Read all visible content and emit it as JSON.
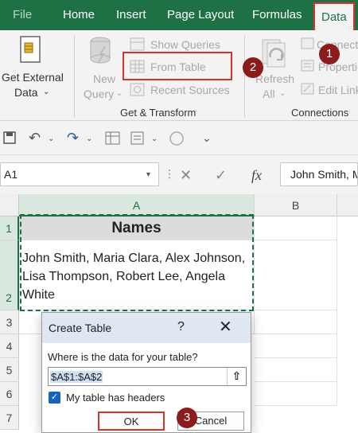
{
  "ribbon_tabs": [
    {
      "label": "File"
    },
    {
      "label": "Home"
    },
    {
      "label": "Insert"
    },
    {
      "label": "Page Layout"
    },
    {
      "label": "Formulas"
    },
    {
      "label": "Data"
    }
  ],
  "get_external_data": {
    "line1": "Get External",
    "line2": "Data"
  },
  "new_query": {
    "line1": "New",
    "line2": "Query"
  },
  "get_transform": {
    "show_queries": "Show Queries",
    "from_table": "From Table",
    "recent_sources": "Recent Sources",
    "group_label": "Get & Transform"
  },
  "refresh_all": {
    "line1": "Refresh",
    "line2": "All"
  },
  "connections": {
    "connections_item": "Connections",
    "properties_item": "Properties",
    "edit_links_item": "Edit Links",
    "group_label": "Connections"
  },
  "formula_bar": {
    "name_box": "A1",
    "fx": "fx",
    "value": "John Smith, Maria Clara, Alex Johnson, Lisa Thompson, Robert Lee, Angela White"
  },
  "grid": {
    "columns": [
      "A",
      "B"
    ],
    "rows": [
      "1",
      "2",
      "3",
      "4",
      "5",
      "6",
      "7"
    ],
    "a1": "Names",
    "a2": "John Smith, Maria Clara, Alex Johnson, Lisa Thompson, Robert Lee, Angela White"
  },
  "dialog": {
    "title": "Create Table",
    "help": "?",
    "prompt": "Where is the data for your table?",
    "range": "$A$1:$A$2",
    "has_headers_label": "My table has headers",
    "has_headers_checked": true,
    "ok": "OK",
    "cancel": "Cancel"
  },
  "callouts": {
    "one": "1",
    "two": "2",
    "three": "3"
  },
  "colors": {
    "excel_green": "#1e7145",
    "callout_red": "#8c1c1c",
    "highlight_red": "#d9342b"
  }
}
